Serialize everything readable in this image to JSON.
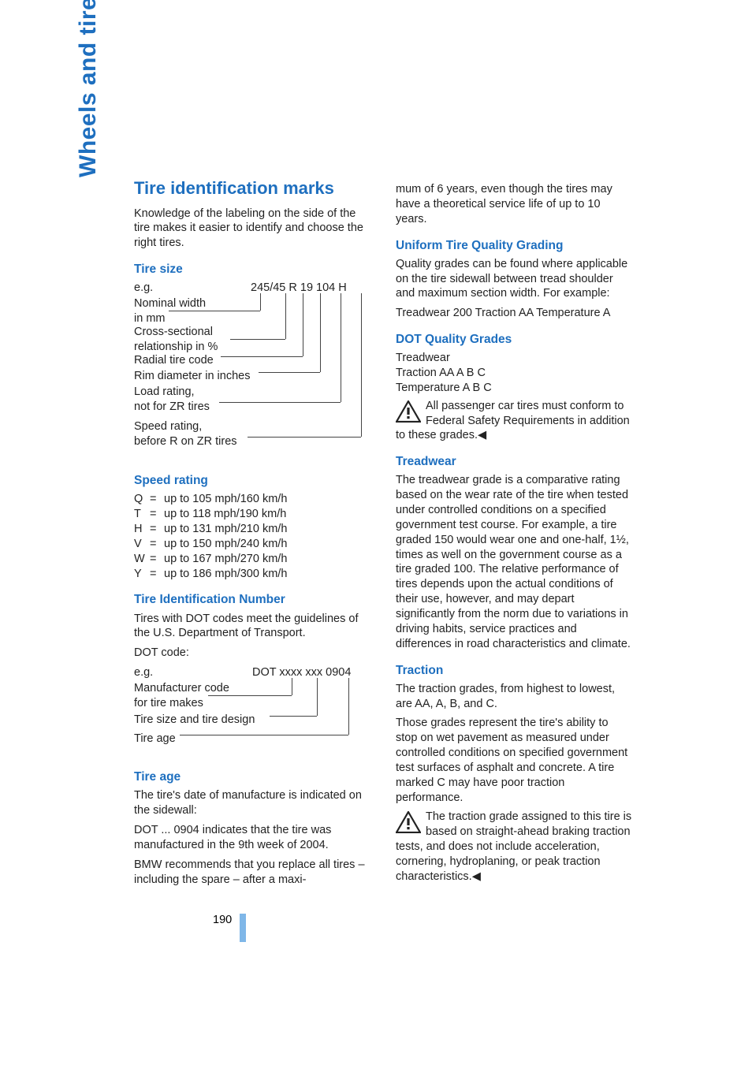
{
  "sidebar": {
    "label": "Wheels and tires"
  },
  "left": {
    "title": "Tire identification marks",
    "intro": "Knowledge of the labeling on the side of the tire makes it easier to identify and choose the right tires.",
    "tireSize": {
      "heading": "Tire size",
      "eg": "e.g.",
      "spec": "245/45  R  19 104 H",
      "r1a": "Nominal width",
      "r1b": "in mm",
      "r2a": "Cross-sectional",
      "r2b": "relationship in %",
      "r3": "Radial tire code",
      "r4": "Rim diameter in inches",
      "r5a": "Load rating,",
      "r5b": "not for ZR tires",
      "r6a": "Speed rating,",
      "r6b": "before R on ZR tires"
    },
    "speedRating": {
      "heading": "Speed rating",
      "rows": [
        {
          "l": "Q",
          "v": "up to 105 mph/160 km/h"
        },
        {
          "l": "T",
          "v": "up to 118 mph/190 km/h"
        },
        {
          "l": "H",
          "v": "up to 131 mph/210 km/h"
        },
        {
          "l": "V",
          "v": "up to 150 mph/240 km/h"
        },
        {
          "l": "W",
          "v": "up to 167 mph/270 km/h"
        },
        {
          "l": "Y",
          "v": "up to 186 mph/300 km/h"
        }
      ]
    },
    "tin": {
      "heading": "Tire Identification Number",
      "p1": "Tires with DOT codes meet the guidelines of the U.S. Department of Transport.",
      "p2": "DOT code:",
      "eg": "e.g.",
      "spec": "DOT xxxx xxx 0904",
      "r1a": "Manufacturer code",
      "r1b": "for tire makes",
      "r2": "Tire size and tire design",
      "r3": "Tire age"
    },
    "tireAge": {
      "heading": "Tire age",
      "p1": "The tire's date of manufacture is indicated on the sidewall:",
      "p2": "DOT ... 0904 indicates that the tire was manufactured in the 9th week of 2004.",
      "p3": "BMW recommends that you replace all tires – including the spare – after a maxi-"
    }
  },
  "right": {
    "cont": "mum of 6 years, even though the tires may have a theoretical service life of up to 10 years.",
    "utqg": {
      "heading": "Uniform Tire Quality Grading",
      "p1": "Quality grades can be found where applicable on the tire sidewall between tread shoulder and maximum section width. For example:",
      "p2": "Treadwear 200 Traction AA Temperature A"
    },
    "dot": {
      "heading": "DOT Quality Grades",
      "l1": "Treadwear",
      "l2": "Traction AA A B C",
      "l3": "Temperature A B C",
      "warn": "All passenger car tires must conform to Federal Safety Requirements in addition to these grades."
    },
    "treadwear": {
      "heading": "Treadwear",
      "p": "The treadwear grade is a comparative rating based on the wear rate of the tire when tested under controlled conditions on a specified government test course. For example, a tire graded 150 would wear one and one-half, 1½, times as well on the government course as a tire graded 100. The relative performance of tires depends upon the actual conditions of their use, however, and may depart significantly from the norm due to variations in driving habits, service practices and differences in road characteristics and climate."
    },
    "traction": {
      "heading": "Traction",
      "p1": "The traction grades, from highest to lowest, are AA, A, B, and C.",
      "p2": "Those grades represent the tire's ability to stop on wet pavement as measured under controlled conditions on specified government test surfaces of asphalt and concrete. A tire marked C may have poor traction performance.",
      "warn": "The traction grade assigned to this tire is based on straight-ahead braking traction tests, and does not include acceleration, cornering, hydroplaning, or peak traction characteristics."
    }
  },
  "pageNumber": "190",
  "icons": {
    "endMark": "◀"
  }
}
